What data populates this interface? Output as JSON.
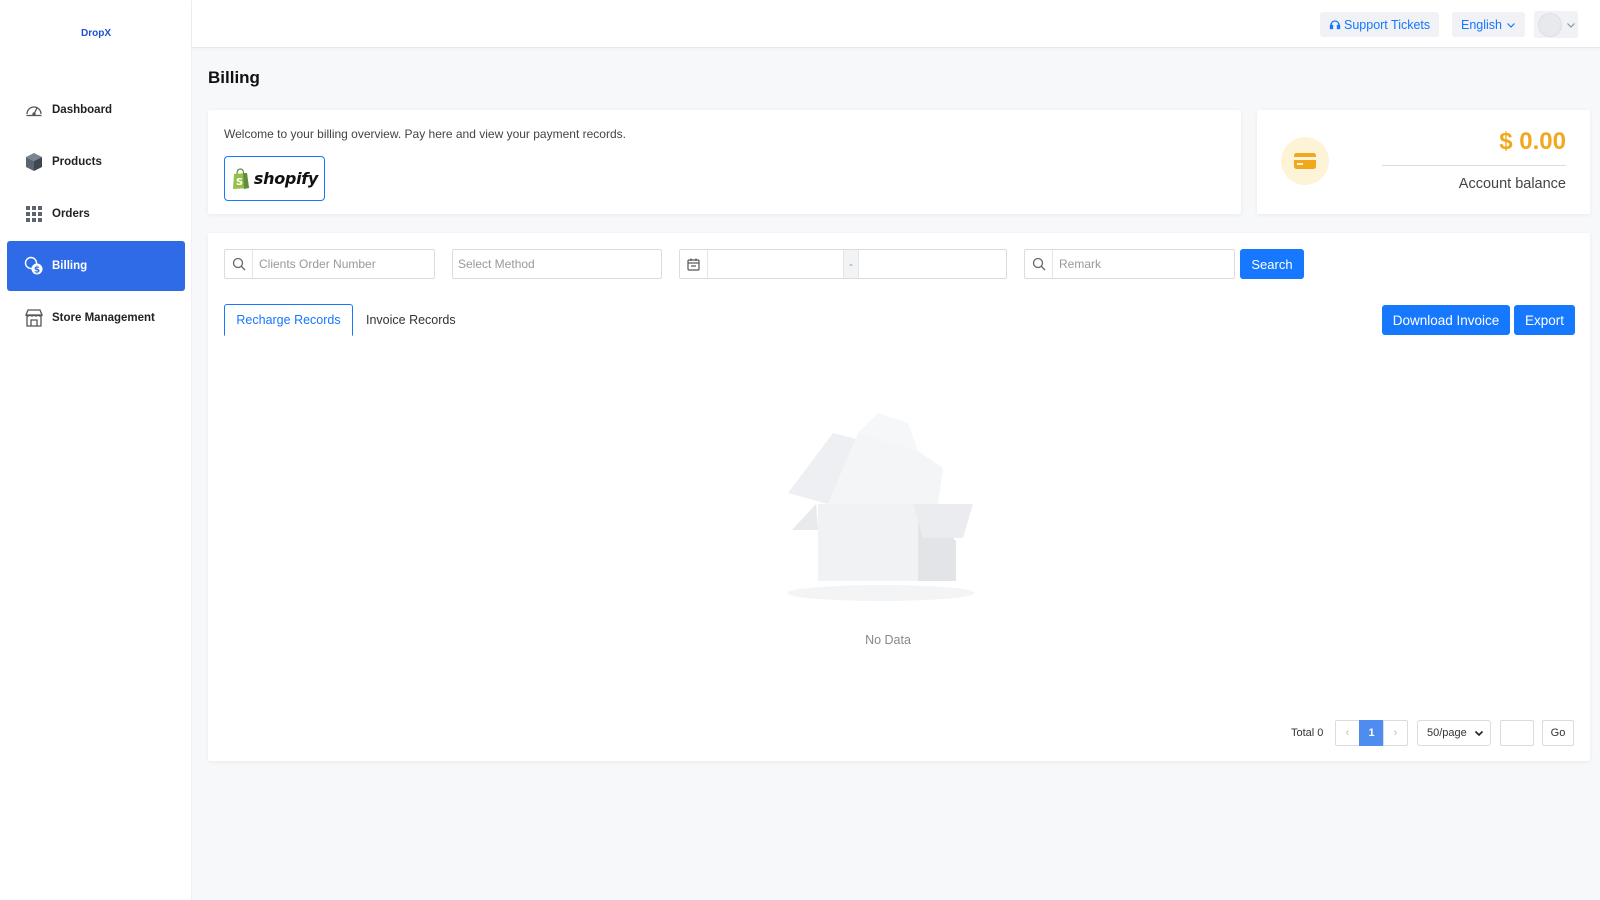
{
  "app": {
    "logo": "DropX"
  },
  "sidebar": {
    "items": [
      {
        "label": "Dashboard",
        "icon": "dashboard-gauge-icon"
      },
      {
        "label": "Products",
        "icon": "box-icon"
      },
      {
        "label": "Orders",
        "icon": "grid-icon"
      },
      {
        "label": "Billing",
        "icon": "coins-dollar-icon",
        "active": true
      },
      {
        "label": "Store Management",
        "icon": "storefront-icon"
      }
    ]
  },
  "header": {
    "support_label": "Support Tickets",
    "language": "English"
  },
  "page": {
    "title": "Billing"
  },
  "welcome": {
    "text": "Welcome to your billing overview. Pay here and view your payment records.",
    "shopify_label": "shopify"
  },
  "balance": {
    "amount": "$ 0.00",
    "label": "Account balance"
  },
  "filters": {
    "order_placeholder": "Clients Order Number",
    "method_placeholder": "Select Method",
    "date_separator": "-",
    "remark_placeholder": "Remark",
    "search_label": "Search"
  },
  "tabs": [
    {
      "label": "Recharge Records",
      "active": true
    },
    {
      "label": "Invoice Records",
      "active": false
    }
  ],
  "actions": {
    "download_invoice": "Download Invoice",
    "export": "Export"
  },
  "empty_state": {
    "text": "No Data"
  },
  "pagination": {
    "total_label": "Total 0",
    "prev": "‹",
    "current_page": "1",
    "next": "›",
    "page_size": "50/page",
    "go_label": "Go"
  },
  "colors": {
    "primary": "#1677ff",
    "sidebar_active": "#2f6be6",
    "balance": "#f0a91c"
  }
}
